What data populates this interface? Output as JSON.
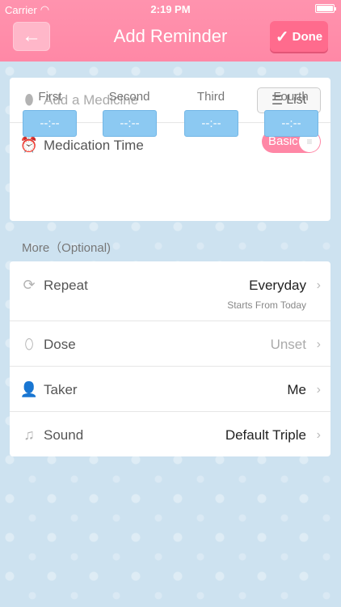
{
  "status": {
    "carrier": "Carrier",
    "time": "2:19 PM"
  },
  "nav": {
    "title": "Add Reminder",
    "done_label": "Done"
  },
  "medicine": {
    "placeholder": "Add a Medicine",
    "list_label": "List"
  },
  "medtime": {
    "label": "Medication Time",
    "toggle_label": "Basic",
    "slots": [
      {
        "label": "First",
        "value": "--:--"
      },
      {
        "label": "Second",
        "value": "--:--"
      },
      {
        "label": "Third",
        "value": "--:--"
      },
      {
        "label": "Fourth",
        "value": "--:--"
      }
    ]
  },
  "more": {
    "title": "More（Optional)"
  },
  "options": {
    "repeat": {
      "label": "Repeat",
      "value": "Everyday",
      "sub": "Starts From Today"
    },
    "dose": {
      "label": "Dose",
      "value": "Unset"
    },
    "taker": {
      "label": "Taker",
      "value": "Me"
    },
    "sound": {
      "label": "Sound",
      "value": "Default Triple"
    }
  },
  "colors": {
    "nav": "#ff8eaa",
    "accent": "#ff6b8d",
    "slot": "#8cc9f2",
    "background": "#cde2f0"
  }
}
